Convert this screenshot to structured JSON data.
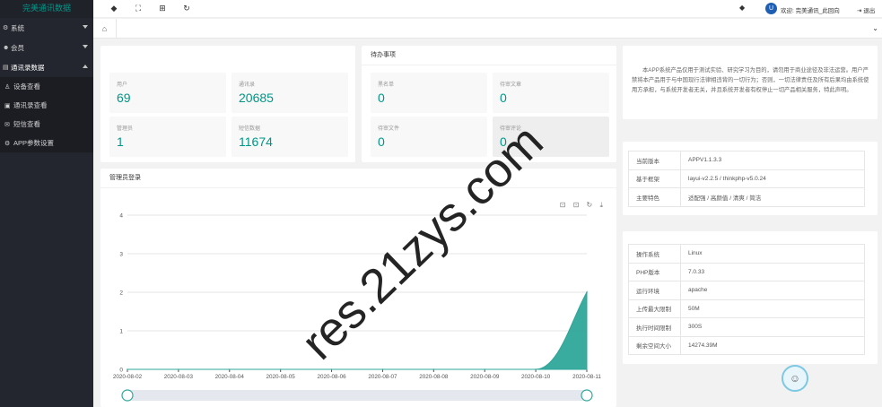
{
  "app": {
    "title": "完美通讯数据"
  },
  "sidebar": {
    "items": [
      {
        "label": "系统",
        "icon": "gear-icon",
        "glyph": "⚙",
        "expanded": false
      },
      {
        "label": "会员",
        "icon": "users-icon",
        "glyph": "☻",
        "expanded": false
      },
      {
        "label": "通讯录数据",
        "icon": "book-icon",
        "glyph": "▤",
        "expanded": true
      }
    ],
    "subitems": [
      {
        "label": "设备查看",
        "icon": "user-icon",
        "glyph": "♙"
      },
      {
        "label": "通讯录查看",
        "icon": "contacts-icon",
        "glyph": "▣"
      },
      {
        "label": "短信查看",
        "icon": "mail-icon",
        "glyph": "✉"
      },
      {
        "label": "APP参数设置",
        "icon": "settings-icon",
        "glyph": "⚙"
      }
    ]
  },
  "header": {
    "toolbar_glyphs": [
      "◆",
      "⛶",
      "⊞",
      "↻"
    ],
    "tag_glyph": "◆",
    "avatar_glyph": "U",
    "welcome": "欢迎: 完美通讯_此回向",
    "logout": "退出",
    "logout_glyph": "⇥"
  },
  "tabs": {
    "home_glyph": "⌂",
    "more_glyph": "⌄"
  },
  "stats": [
    {
      "label": "用户",
      "value": "69"
    },
    {
      "label": "通讯录",
      "value": "20685"
    },
    {
      "label": "管理员",
      "value": "1"
    },
    {
      "label": "短信数据",
      "value": "11674"
    }
  ],
  "todo": {
    "title": "待办事项",
    "items": [
      {
        "label": "黑名单",
        "value": "0"
      },
      {
        "label": "待审文章",
        "value": "0"
      },
      {
        "label": "待审文件",
        "value": "0"
      },
      {
        "label": "待审评论",
        "value": "0"
      }
    ]
  },
  "notice": {
    "text": "本APP系统产品仅用于测试实验、研究学习为目的，请勿用于商业途径及非法运营。用户严禁将本产品用于与中国现行法律相违背的一切行为；否则，一切法律责任及所有后果均由系统使用方承担，与系统开发者无关，并且系统开发者有权停止一切产品相关服务，特此声明。"
  },
  "version_info": [
    {
      "key": "当前版本",
      "value": "APPV1.1.3.3"
    },
    {
      "key": "基于框架",
      "value": "layui-v2.2.5 / thinkphp-v5.0.24"
    },
    {
      "key": "主要特色",
      "value": "适配强 / 高颜值 / 清爽 / 简洁"
    }
  ],
  "system_info": [
    {
      "key": "操作系统",
      "value": "Linux"
    },
    {
      "key": "PHP版本",
      "value": "7.0.33"
    },
    {
      "key": "运行环境",
      "value": "apache"
    },
    {
      "key": "上传最大限制",
      "value": "50M"
    },
    {
      "key": "执行时间限制",
      "value": "300S"
    },
    {
      "key": "剩余空间大小",
      "value": "14274.39M"
    }
  ],
  "watermark": "res.21zys.com",
  "float_glyph": "☺",
  "chart_tools_glyphs": "⊡ ⊡ ↻ ⤓",
  "colors": {
    "accent": "#009688",
    "sidebar": "#23262e"
  },
  "chart_data": {
    "type": "area",
    "title": "管理员登录",
    "x": [
      "2020-08-02",
      "2020-08-03",
      "2020-08-04",
      "2020-08-05",
      "2020-08-06",
      "2020-08-07",
      "2020-08-08",
      "2020-08-09",
      "2020-08-10",
      "2020-08-11"
    ],
    "series": [
      {
        "values": [
          0,
          0,
          0,
          0,
          0,
          0,
          0,
          0,
          0,
          2
        ]
      }
    ],
    "ylim": [
      0,
      4
    ],
    "yticks": [
      0,
      1,
      2,
      3,
      4
    ],
    "grid": true,
    "color": "#2fa69a"
  }
}
